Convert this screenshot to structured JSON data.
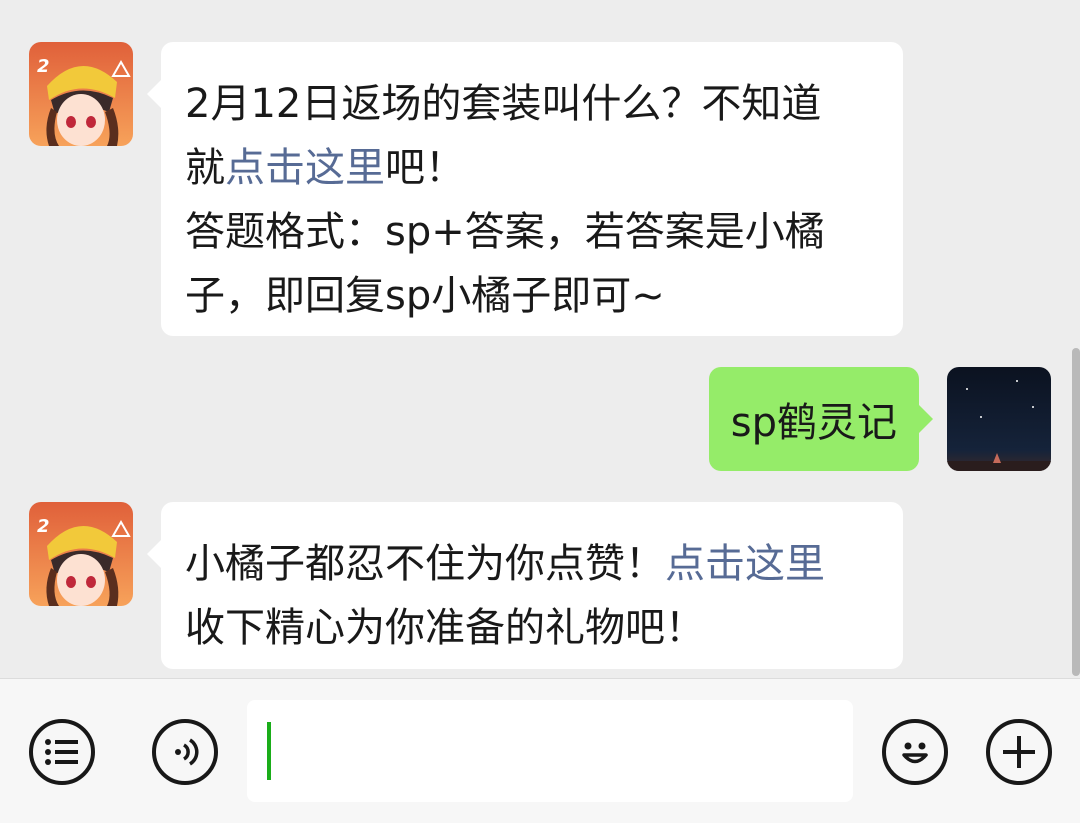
{
  "messages": [
    {
      "side": "in",
      "avatar": "game-character-avatar-icon",
      "lines": [
        {
          "parts": [
            "2月12日返场的套装叫什么？不知道"
          ]
        },
        {
          "parts": [
            "就",
            {
              "link": "点击这里"
            },
            "吧！"
          ]
        },
        {
          "parts": [
            "答题格式：sp+答案，若答案是小橘"
          ]
        },
        {
          "parts": [
            "子，即回复sp小橘子即可~"
          ]
        }
      ]
    },
    {
      "side": "out",
      "avatar": "night-moon-avatar-icon",
      "text": "sp鹤灵记"
    },
    {
      "side": "in",
      "avatar": "game-character-avatar-icon",
      "lines": [
        {
          "parts": [
            "小橘子都忍不住为你点赞！",
            {
              "link": "点击这里"
            }
          ]
        },
        {
          "parts": [
            "收下精心为你准备的礼物吧！"
          ]
        }
      ]
    }
  ],
  "msg1": {
    "line1": "2月12日返场的套装叫什么？不知道",
    "line2_pre": "就",
    "line2_link": "点击这里",
    "line2_post": "吧！",
    "line3": "答题格式：sp+答案，若答案是小橘",
    "line4": "子，即回复sp小橘子即可~"
  },
  "msg2": {
    "text": "sp鹤灵记"
  },
  "msg3": {
    "line1_pre": "小橘子都忍不住为你点赞！",
    "line1_link": "点击这里",
    "line2": "收下精心为你准备的礼物吧！"
  },
  "input_bar": {
    "left_icons": [
      "menu-list-icon",
      "voice-icon"
    ],
    "right_icons": [
      "emoji-icon",
      "add-icon"
    ],
    "input_value": ""
  },
  "colors": {
    "background": "#ededed",
    "incoming_bubble": "#ffffff",
    "outgoing_bubble": "#95ec69",
    "link": "#576b95",
    "caret": "#1aad19"
  }
}
